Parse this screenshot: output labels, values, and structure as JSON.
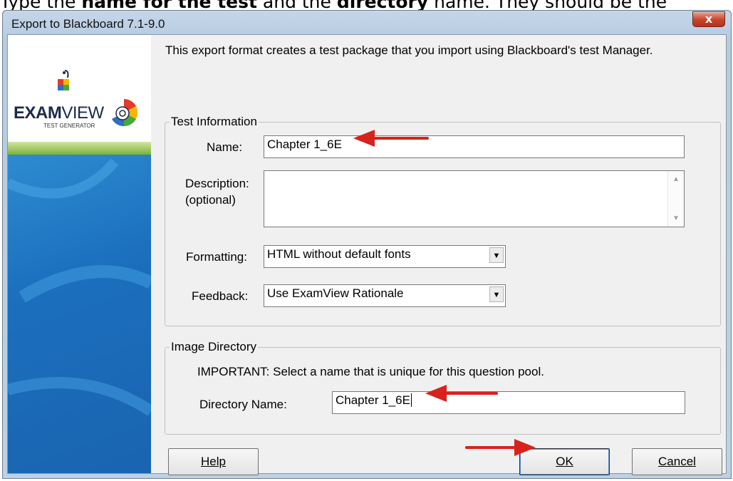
{
  "document": {
    "prefix": "Type the ",
    "bold1": "name for the test",
    "middle": " and the ",
    "bold2": "directory",
    "suffix": " name. They should be the"
  },
  "window": {
    "title": "Export to Blackboard 7.1-9.0",
    "close_glyph": "x"
  },
  "sidebar": {
    "logo_bold": "EXAM",
    "logo_thin": "VIEW",
    "logo_sub": "TEST GENERATOR"
  },
  "intro": "This export format creates a test package that you import using Blackboard's test Manager.",
  "test_info": {
    "legend": "Test Information",
    "name_label": "Name:",
    "name_value": "Chapter 1_6E",
    "description_label": "Description:",
    "description_label2": "(optional)",
    "description_value": "",
    "formatting_label": "Formatting:",
    "formatting_value": "HTML without default fonts",
    "feedback_label": "Feedback:",
    "feedback_value": "Use ExamView Rationale"
  },
  "image_dir": {
    "legend": "Image Directory",
    "important": "IMPORTANT: Select a name that is unique for this question pool.",
    "dir_label": "Directory Name:",
    "dir_value": "Chapter 1_6E"
  },
  "buttons": {
    "help": "Help",
    "ok": "OK",
    "cancel": "Cancel"
  },
  "colors": {
    "annotation_arrow": "#d8221c",
    "sidebar_blue": "#1b6fbd"
  }
}
